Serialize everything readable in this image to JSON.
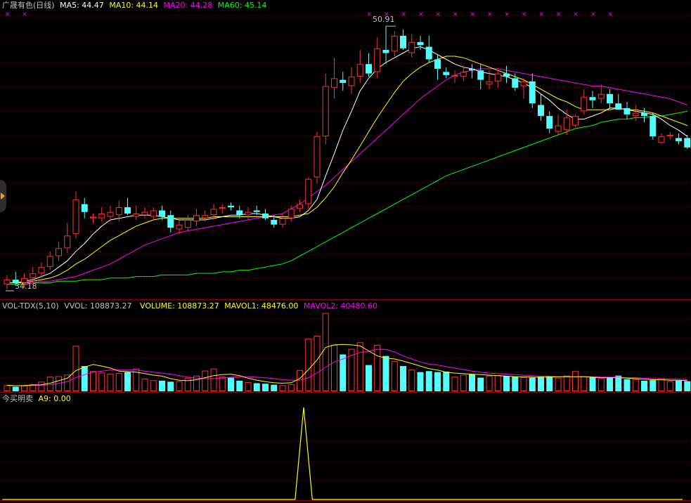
{
  "colors": {
    "up": "#ff3232",
    "down": "#54fcfc",
    "ma5": "#ffffff",
    "ma10": "#ffff00",
    "ma20": "#ff00ff",
    "ma60": "#00ff00",
    "grid": "#8b0000",
    "text": "#c0c0c0",
    "mark": "#ff00ff"
  },
  "price_panel": {
    "title": "广晟有色(日线)",
    "ma5": "MA5: 44.47",
    "ma10": "MA10: 44.14",
    "ma20": "MA20: 44.28",
    "ma60": "MA60: 45.14",
    "high_label": "50.91",
    "low_label": "34.18"
  },
  "volume_panel": {
    "name": "VOL-TDX(5,10)",
    "vvol": "VVOL: 108873.27",
    "volume": "VOLUME: 108873.27",
    "mavol1": "MAVOL1: 48476.00",
    "mavol2": "MAVOL2: 40480.60"
  },
  "indicator_panel": {
    "name": "今买明卖",
    "a9": "A9: 0.00"
  },
  "chart_data": [
    {
      "type": "candlestick",
      "title": "广晟有色(日线)",
      "ylim": [
        34,
        51.5
      ],
      "candles": [
        {
          "o": 34.5,
          "h": 35.1,
          "l": 34.18,
          "c": 34.8
        },
        {
          "o": 34.8,
          "h": 35.3,
          "l": 34.4,
          "c": 34.6
        },
        {
          "o": 34.6,
          "h": 35.2,
          "l": 34.3,
          "c": 34.9
        },
        {
          "o": 34.9,
          "h": 35.6,
          "l": 34.6,
          "c": 35.2
        },
        {
          "o": 35.2,
          "h": 35.9,
          "l": 34.9,
          "c": 35.6
        },
        {
          "o": 35.6,
          "h": 36.6,
          "l": 35.4,
          "c": 36.3
        },
        {
          "o": 36.3,
          "h": 37.2,
          "l": 36.0,
          "c": 36.8
        },
        {
          "o": 36.8,
          "h": 38.4,
          "l": 36.5,
          "c": 37.6
        },
        {
          "o": 37.7,
          "h": 40.4,
          "l": 37.4,
          "c": 39.9
        },
        {
          "o": 39.6,
          "h": 40.0,
          "l": 38.7,
          "c": 39.1
        },
        {
          "o": 38.7,
          "h": 39.0,
          "l": 38.4,
          "c": 38.8
        },
        {
          "o": 38.7,
          "h": 39.4,
          "l": 38.5,
          "c": 39.0
        },
        {
          "o": 38.8,
          "h": 39.5,
          "l": 38.5,
          "c": 39.1
        },
        {
          "o": 38.9,
          "h": 39.8,
          "l": 38.5,
          "c": 39.4
        },
        {
          "o": 39.4,
          "h": 40.0,
          "l": 38.9,
          "c": 39.0
        },
        {
          "o": 38.8,
          "h": 39.5,
          "l": 38.6,
          "c": 39.0
        },
        {
          "o": 38.9,
          "h": 39.4,
          "l": 38.7,
          "c": 39.1
        },
        {
          "o": 38.8,
          "h": 39.4,
          "l": 38.6,
          "c": 39.2
        },
        {
          "o": 39.2,
          "h": 39.5,
          "l": 38.6,
          "c": 38.8
        },
        {
          "o": 38.9,
          "h": 39.2,
          "l": 37.8,
          "c": 38.1
        },
        {
          "o": 38.0,
          "h": 38.6,
          "l": 37.7,
          "c": 38.3
        },
        {
          "o": 38.1,
          "h": 38.9,
          "l": 37.9,
          "c": 38.6
        },
        {
          "o": 38.5,
          "h": 39.3,
          "l": 38.2,
          "c": 38.9
        },
        {
          "o": 38.7,
          "h": 39.2,
          "l": 38.5,
          "c": 38.9
        },
        {
          "o": 38.9,
          "h": 39.6,
          "l": 38.6,
          "c": 39.3
        },
        {
          "o": 39.3,
          "h": 39.6,
          "l": 39.0,
          "c": 39.4
        },
        {
          "o": 39.5,
          "h": 39.7,
          "l": 39.2,
          "c": 39.4
        },
        {
          "o": 39.2,
          "h": 39.5,
          "l": 38.7,
          "c": 38.9
        },
        {
          "o": 38.9,
          "h": 39.4,
          "l": 38.6,
          "c": 39.1
        },
        {
          "o": 39.2,
          "h": 39.5,
          "l": 38.9,
          "c": 39.1
        },
        {
          "o": 39.0,
          "h": 39.3,
          "l": 38.6,
          "c": 38.7
        },
        {
          "o": 38.6,
          "h": 38.9,
          "l": 38.1,
          "c": 38.3
        },
        {
          "o": 38.3,
          "h": 39.0,
          "l": 38.1,
          "c": 38.7
        },
        {
          "o": 38.7,
          "h": 39.5,
          "l": 38.5,
          "c": 39.3
        },
        {
          "o": 39.3,
          "h": 39.9,
          "l": 39.1,
          "c": 39.6
        },
        {
          "o": 39.6,
          "h": 41.3,
          "l": 39.3,
          "c": 41.2
        },
        {
          "o": 41.3,
          "h": 44.2,
          "l": 40.9,
          "c": 43.9
        },
        {
          "o": 43.9,
          "h": 47.9,
          "l": 43.4,
          "c": 47.1
        },
        {
          "o": 47.0,
          "h": 48.9,
          "l": 46.3,
          "c": 47.6
        },
        {
          "o": 47.5,
          "h": 48.0,
          "l": 46.8,
          "c": 47.3
        },
        {
          "o": 47.1,
          "h": 48.3,
          "l": 46.6,
          "c": 47.7
        },
        {
          "o": 47.7,
          "h": 49.4,
          "l": 47.3,
          "c": 48.5
        },
        {
          "o": 48.5,
          "h": 49.2,
          "l": 47.7,
          "c": 47.9
        },
        {
          "o": 48.0,
          "h": 50.2,
          "l": 47.6,
          "c": 49.5
        },
        {
          "o": 49.4,
          "h": 50.91,
          "l": 48.5,
          "c": 49.2
        },
        {
          "o": 49.3,
          "h": 50.6,
          "l": 49.0,
          "c": 50.3
        },
        {
          "o": 50.3,
          "h": 50.7,
          "l": 49.4,
          "c": 49.5
        },
        {
          "o": 49.2,
          "h": 50.4,
          "l": 48.9,
          "c": 49.9
        },
        {
          "o": 49.9,
          "h": 50.3,
          "l": 49.4,
          "c": 49.7
        },
        {
          "o": 49.6,
          "h": 50.3,
          "l": 48.6,
          "c": 48.8
        },
        {
          "o": 48.8,
          "h": 49.1,
          "l": 47.5,
          "c": 48.2
        },
        {
          "o": 48.0,
          "h": 48.3,
          "l": 47.6,
          "c": 47.8
        },
        {
          "o": 47.7,
          "h": 48.1,
          "l": 47.3,
          "c": 47.8
        },
        {
          "o": 47.7,
          "h": 48.4,
          "l": 47.4,
          "c": 48.0
        },
        {
          "o": 48.2,
          "h": 48.5,
          "l": 47.6,
          "c": 48.1
        },
        {
          "o": 48.1,
          "h": 48.5,
          "l": 46.9,
          "c": 47.5
        },
        {
          "o": 47.2,
          "h": 48.1,
          "l": 46.9,
          "c": 47.4
        },
        {
          "o": 47.4,
          "h": 48.1,
          "l": 47.0,
          "c": 47.9
        },
        {
          "o": 47.9,
          "h": 48.4,
          "l": 47.3,
          "c": 47.7
        },
        {
          "o": 47.6,
          "h": 47.9,
          "l": 46.8,
          "c": 47.0
        },
        {
          "o": 47.1,
          "h": 47.6,
          "l": 46.3,
          "c": 47.4
        },
        {
          "o": 47.4,
          "h": 47.9,
          "l": 45.7,
          "c": 46.0
        },
        {
          "o": 45.9,
          "h": 46.6,
          "l": 44.9,
          "c": 45.2
        },
        {
          "o": 45.2,
          "h": 45.5,
          "l": 44.1,
          "c": 44.4
        },
        {
          "o": 44.2,
          "h": 45.3,
          "l": 44.0,
          "c": 44.6
        },
        {
          "o": 44.3,
          "h": 45.6,
          "l": 44.0,
          "c": 45.1
        },
        {
          "o": 44.6,
          "h": 45.3,
          "l": 44.5,
          "c": 45.2
        },
        {
          "o": 45.5,
          "h": 46.9,
          "l": 45.3,
          "c": 46.4
        },
        {
          "o": 46.4,
          "h": 46.8,
          "l": 45.7,
          "c": 46.2
        },
        {
          "o": 46.3,
          "h": 47.2,
          "l": 46.0,
          "c": 46.6
        },
        {
          "o": 46.6,
          "h": 46.9,
          "l": 45.7,
          "c": 46.0
        },
        {
          "o": 46.0,
          "h": 46.6,
          "l": 45.7,
          "c": 45.6
        },
        {
          "o": 45.7,
          "h": 46.1,
          "l": 45.0,
          "c": 45.3
        },
        {
          "o": 45.2,
          "h": 45.9,
          "l": 44.9,
          "c": 45.4
        },
        {
          "o": 45.4,
          "h": 45.7,
          "l": 44.8,
          "c": 45.2
        },
        {
          "o": 45.2,
          "h": 45.4,
          "l": 43.7,
          "c": 43.9
        },
        {
          "o": 43.5,
          "h": 44.1,
          "l": 43.4,
          "c": 43.9
        },
        {
          "o": 43.9,
          "h": 44.2,
          "l": 43.7,
          "c": 44.0
        },
        {
          "o": 43.8,
          "h": 44.1,
          "l": 43.4,
          "c": 43.6
        },
        {
          "o": 43.8,
          "h": 44.0,
          "l": 43.1,
          "c": 43.2
        }
      ],
      "ma5": [
        34.6,
        34.6,
        34.7,
        34.8,
        35.0,
        35.2,
        35.6,
        36.0,
        36.6,
        37.1,
        37.7,
        38.2,
        38.6,
        38.7,
        38.8,
        38.9,
        38.9,
        38.9,
        38.8,
        38.7,
        38.6,
        38.6,
        38.6,
        38.6,
        38.7,
        38.8,
        38.9,
        38.9,
        39.0,
        39.0,
        38.9,
        38.8,
        38.7,
        38.7,
        38.8,
        39.2,
        39.9,
        41.4,
        42.8,
        44.3,
        45.5,
        46.8,
        47.6,
        48.2,
        48.6,
        48.9,
        49.2,
        49.5,
        49.6,
        49.4,
        49.1,
        48.8,
        48.5,
        48.3,
        48.2,
        48.0,
        47.9,
        47.8,
        47.7,
        47.5,
        47.3,
        47.0,
        46.6,
        46.2,
        45.7,
        45.3,
        45.0,
        45.0,
        45.2,
        45.4,
        45.7,
        45.7,
        45.6,
        45.5,
        45.4,
        45.3,
        45.0,
        44.6,
        44.3,
        43.9
      ],
      "ma10": [
        34.6,
        34.6,
        34.6,
        34.7,
        34.8,
        34.9,
        35.1,
        35.4,
        35.8,
        36.1,
        36.5,
        36.9,
        37.3,
        37.6,
        37.9,
        38.2,
        38.4,
        38.6,
        38.7,
        38.7,
        38.7,
        38.7,
        38.7,
        38.7,
        38.8,
        38.8,
        38.8,
        38.8,
        38.8,
        38.8,
        38.8,
        38.8,
        38.8,
        38.8,
        38.9,
        39.0,
        39.4,
        40.0,
        40.7,
        41.6,
        42.4,
        43.3,
        44.2,
        45.1,
        45.9,
        46.7,
        47.4,
        47.9,
        48.3,
        48.6,
        48.8,
        49.0,
        49.0,
        48.9,
        48.7,
        48.5,
        48.3,
        48.1,
        47.9,
        47.7,
        47.5,
        47.2,
        46.9,
        46.6,
        46.3,
        46.1,
        45.8,
        45.6,
        45.6,
        45.6,
        45.6,
        45.7,
        45.6,
        45.6,
        45.5,
        45.4,
        45.2,
        45.0,
        44.8,
        44.6
      ],
      "ma20": [
        34.6,
        34.6,
        34.6,
        34.6,
        34.7,
        34.7,
        34.8,
        34.9,
        35.0,
        35.2,
        35.4,
        35.6,
        35.8,
        36.1,
        36.4,
        36.7,
        37.0,
        37.2,
        37.4,
        37.6,
        37.8,
        37.9,
        38.0,
        38.1,
        38.2,
        38.3,
        38.4,
        38.5,
        38.6,
        38.7,
        38.8,
        38.9,
        39.0,
        39.3,
        39.6,
        40.0,
        40.4,
        40.8,
        41.3,
        41.8,
        42.3,
        42.8,
        43.3,
        43.8,
        44.3,
        44.8,
        45.3,
        45.8,
        46.3,
        46.7,
        47.1,
        47.5,
        47.8,
        48.0,
        48.1,
        48.2,
        48.2,
        48.2,
        48.1,
        48.0,
        47.9,
        47.8,
        47.7,
        47.6,
        47.5,
        47.4,
        47.3,
        47.2,
        47.1,
        47.1,
        47.0,
        46.9,
        46.8,
        46.7,
        46.6,
        46.5,
        46.4,
        46.3,
        46.1,
        45.9
      ],
      "ma60": [
        34.5,
        34.5,
        34.5,
        34.6,
        34.6,
        34.6,
        34.7,
        34.7,
        34.7,
        34.8,
        34.8,
        34.8,
        34.9,
        34.9,
        34.9,
        35.0,
        35.0,
        35.0,
        35.1,
        35.1,
        35.1,
        35.1,
        35.2,
        35.2,
        35.2,
        35.3,
        35.3,
        35.4,
        35.4,
        35.5,
        35.6,
        35.7,
        35.8,
        36.0,
        36.3,
        36.6,
        36.9,
        37.2,
        37.5,
        37.8,
        38.1,
        38.4,
        38.7,
        39.0,
        39.3,
        39.6,
        39.9,
        40.2,
        40.5,
        40.8,
        41.1,
        41.4,
        41.6,
        41.8,
        42.0,
        42.2,
        42.4,
        42.6,
        42.8,
        43.0,
        43.2,
        43.4,
        43.6,
        43.8,
        44.0,
        44.2,
        44.4,
        44.5,
        44.6,
        44.8,
        44.9,
        45.0,
        45.0,
        45.1,
        45.1,
        45.2,
        45.2,
        45.3,
        45.4,
        45.5
      ]
    },
    {
      "type": "bar",
      "title": "VOL-TDX(5,10)",
      "volume": [
        12000,
        9000,
        11000,
        14000,
        19000,
        29000,
        30000,
        33000,
        90000,
        50000,
        40000,
        37000,
        35000,
        36000,
        38000,
        45000,
        25000,
        22000,
        21000,
        19000,
        20000,
        26000,
        31000,
        41000,
        45000,
        29000,
        27000,
        21000,
        18000,
        16000,
        15000,
        13000,
        12000,
        14000,
        42000,
        104000,
        110000,
        155000,
        92000,
        73000,
        84000,
        97000,
        52000,
        92000,
        70000,
        60000,
        50000,
        43000,
        38000,
        40000,
        38000,
        39000,
        29000,
        33000,
        34000,
        27000,
        31000,
        32000,
        30000,
        29000,
        28000,
        27000,
        29000,
        30000,
        27000,
        31000,
        40000,
        30000,
        29000,
        26000,
        27000,
        31000,
        24000,
        24000,
        21000,
        22000,
        26000,
        20000,
        21000,
        20000
      ],
      "mavol1": [
        12000,
        11000,
        11500,
        12500,
        13000,
        16000,
        21000,
        26000,
        41000,
        48000,
        53000,
        50000,
        46000,
        40000,
        39000,
        38000,
        35000,
        32000,
        30000,
        25000,
        22000,
        21000,
        23000,
        27000,
        31000,
        33000,
        34000,
        31000,
        26000,
        22000,
        19000,
        17000,
        16000,
        17000,
        25000,
        43000,
        62000,
        87000,
        92000,
        93000,
        92000,
        90000,
        80000,
        70000,
        66000,
        64000,
        60000,
        55000,
        50000,
        45000,
        42000,
        38000,
        36000,
        35000,
        34000,
        33000,
        32000,
        31000,
        30000,
        29000,
        29000,
        28000,
        28000,
        28000,
        29000,
        29000,
        29000,
        29000,
        28000,
        27000,
        27000,
        27000,
        26000,
        25000,
        24000,
        23000,
        23000,
        22000,
        22000,
        21000
      ],
      "mavol2": [
        12000,
        11000,
        11000,
        11500,
        12000,
        13000,
        16000,
        19000,
        27000,
        33000,
        38000,
        40000,
        42000,
        42000,
        42000,
        42000,
        40000,
        38000,
        36000,
        34000,
        31000,
        28000,
        26000,
        25000,
        25000,
        26000,
        28000,
        29000,
        29000,
        28000,
        27000,
        25000,
        23000,
        22000,
        22000,
        27000,
        36000,
        48000,
        58000,
        64000,
        71000,
        77000,
        79000,
        83000,
        83000,
        78000,
        70000,
        64000,
        58000,
        54000,
        52000,
        49000,
        46000,
        43000,
        40000,
        38000,
        36000,
        35000,
        34000,
        33000,
        32000,
        31000,
        30000,
        30000,
        29000,
        29000,
        29000,
        29000,
        29000,
        28000,
        28000,
        28000,
        27000,
        27000,
        26000,
        25000,
        25000,
        24000,
        24000,
        23000
      ]
    },
    {
      "type": "line",
      "title": "今买明卖",
      "series": [
        {
          "name": "A9",
          "values": [
            0,
            0,
            0,
            0,
            0,
            0,
            0,
            0,
            0,
            0,
            0,
            0,
            0,
            0,
            0,
            0,
            0,
            0,
            0,
            0,
            0,
            0,
            0,
            0,
            0,
            0,
            0,
            0,
            0,
            0,
            0,
            0,
            0,
            0,
            0,
            1,
            0,
            0,
            0,
            0,
            0,
            0,
            0,
            0,
            0,
            0,
            0,
            0,
            0,
            0,
            0,
            0,
            0,
            0,
            0,
            0,
            0,
            0,
            0,
            0,
            0,
            0,
            0,
            0,
            0,
            0,
            0,
            0,
            0,
            0,
            0,
            0,
            0,
            0,
            0,
            0,
            0,
            0,
            0,
            0
          ]
        }
      ]
    }
  ]
}
